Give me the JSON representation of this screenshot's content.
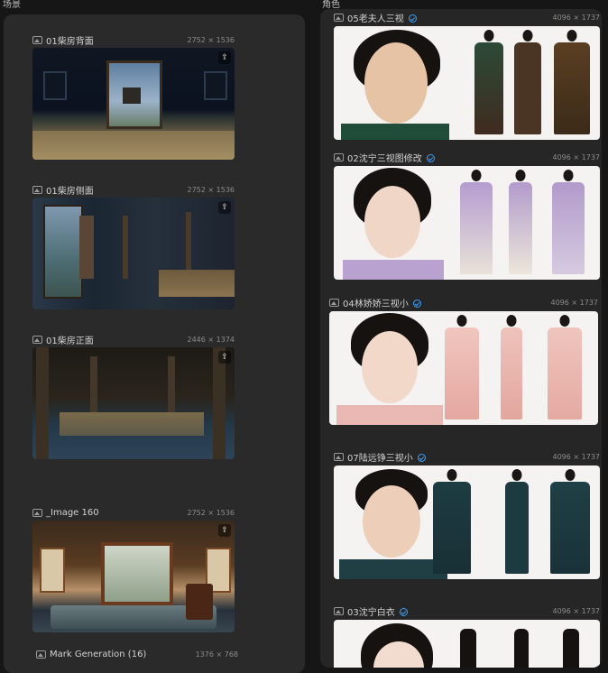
{
  "sections": {
    "scenes_label": "场景",
    "characters_label": "角色"
  },
  "scenes": [
    {
      "title": "01柴房背面",
      "dims": "2752 × 1536"
    },
    {
      "title": "01柴房侧面",
      "dims": "2752 × 1536"
    },
    {
      "title": "01柴房正面",
      "dims": "2446 × 1374"
    },
    {
      "title": "_Image 160",
      "dims": "2752 × 1536"
    },
    {
      "title": "Mark Generation (16)",
      "dims": "1376 × 768"
    }
  ],
  "characters": [
    {
      "title": "05老夫人三视",
      "dims": "4096 × 1737"
    },
    {
      "title": "02沈宁三视图修改",
      "dims": "4096 × 1737"
    },
    {
      "title": "04林娇娇三视小",
      "dims": "4096 × 1737"
    },
    {
      "title": "07陆远铮三视小",
      "dims": "4096 × 1737"
    },
    {
      "title": "03沈宁白衣",
      "dims": "4096 × 1737"
    }
  ],
  "colors": {
    "accent": "#3aa0ff",
    "panel": "#2a2a2a",
    "background": "#161616"
  }
}
